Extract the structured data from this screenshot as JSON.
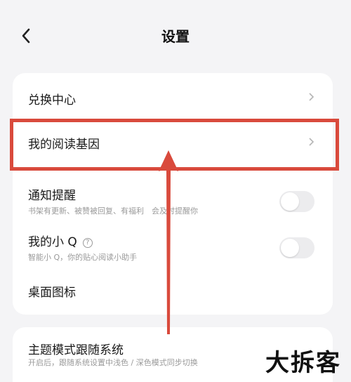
{
  "header": {
    "title": "设置",
    "back_icon": "chevron-left-icon"
  },
  "settings": {
    "exchange_center": {
      "label": "兑换中心",
      "icon": "chevron-right-icon"
    },
    "reading_genes": {
      "label": "我的阅读基因",
      "icon": "chevron-right-icon"
    },
    "notifications": {
      "label": "通知提醒",
      "subtitle": "书架有更新、被赞被回复、有福利　会及时提醒你",
      "enabled": false
    },
    "my_q": {
      "label": "我的小 Q",
      "help_icon": "?",
      "subtitle": "智能小 Q，你的贴心阅读小助手",
      "enabled": false
    },
    "desktop_icon": {
      "label": "桌面图标"
    },
    "theme_follow_system": {
      "label": "主题模式跟随系统",
      "subtitle": "开启后，跟随系统设置中浅色 / 深色模式同步切换"
    }
  },
  "watermark": {
    "text": "大拆客"
  },
  "colors": {
    "highlight": "#d94a3c",
    "background": "#f4f4f6",
    "card": "#ffffff",
    "toggle_off": "#ececee"
  }
}
